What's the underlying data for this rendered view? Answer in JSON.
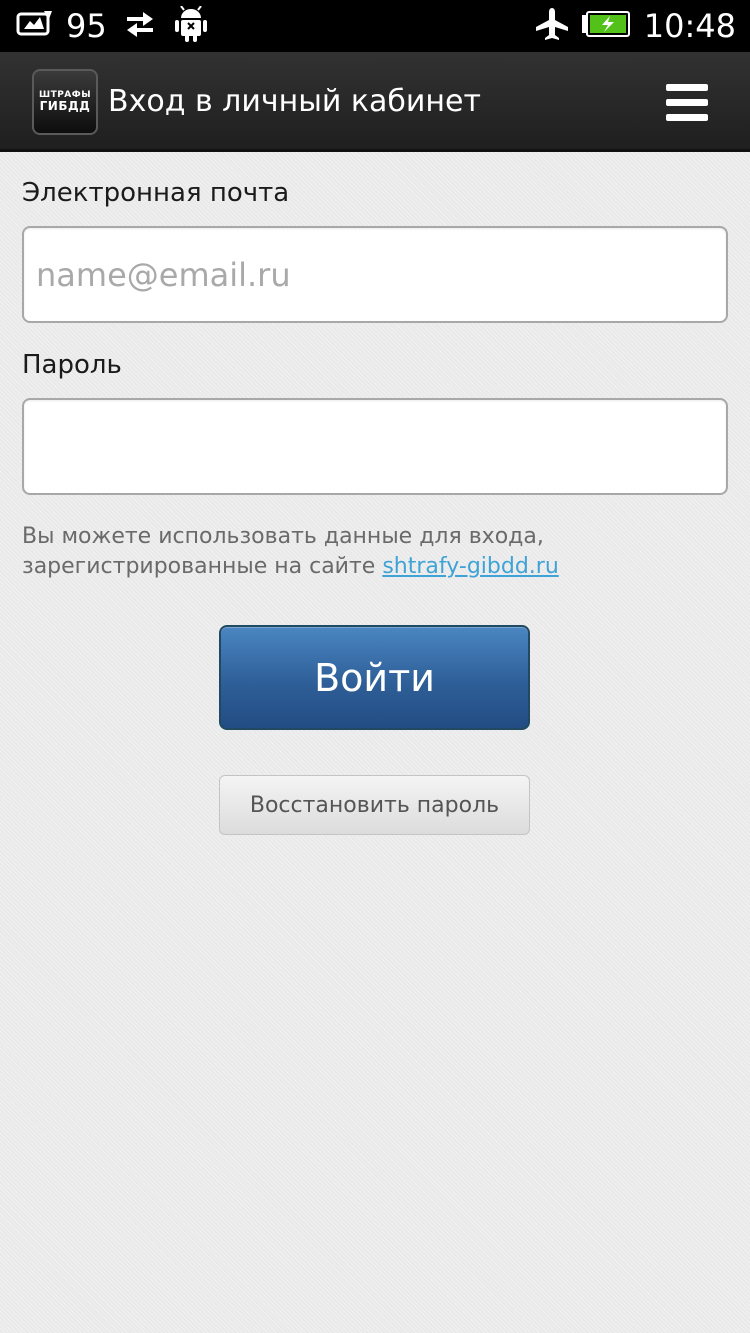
{
  "status_bar": {
    "notification_icon": "message-icon",
    "notification_count": "95",
    "sync_icon": "sync-arrows-icon",
    "debug_icon": "android-debug-icon",
    "airplane_icon": "airplane-icon",
    "battery_icon": "battery-charging-icon",
    "time": "10:48"
  },
  "action_bar": {
    "logo_line1": "ШТРАФЫ",
    "logo_line2": "ГИБДД",
    "title": "Вход в личный кабинет",
    "menu_icon": "hamburger-menu-icon"
  },
  "form": {
    "email_label": "Электронная почта",
    "email_placeholder": "name@email.ru",
    "email_value": "",
    "password_label": "Пароль",
    "password_value": "",
    "hint_text": "Вы можете использовать данные для входа, зарегистрированные на сайте",
    "hint_link": "shtrafy-gibdd.ru",
    "login_button": "Войти",
    "restore_button": "Восстановить пароль"
  },
  "colors": {
    "accent_blue": "#2f5f98",
    "link": "#3ea3d6",
    "battery_green": "#52c21a"
  }
}
